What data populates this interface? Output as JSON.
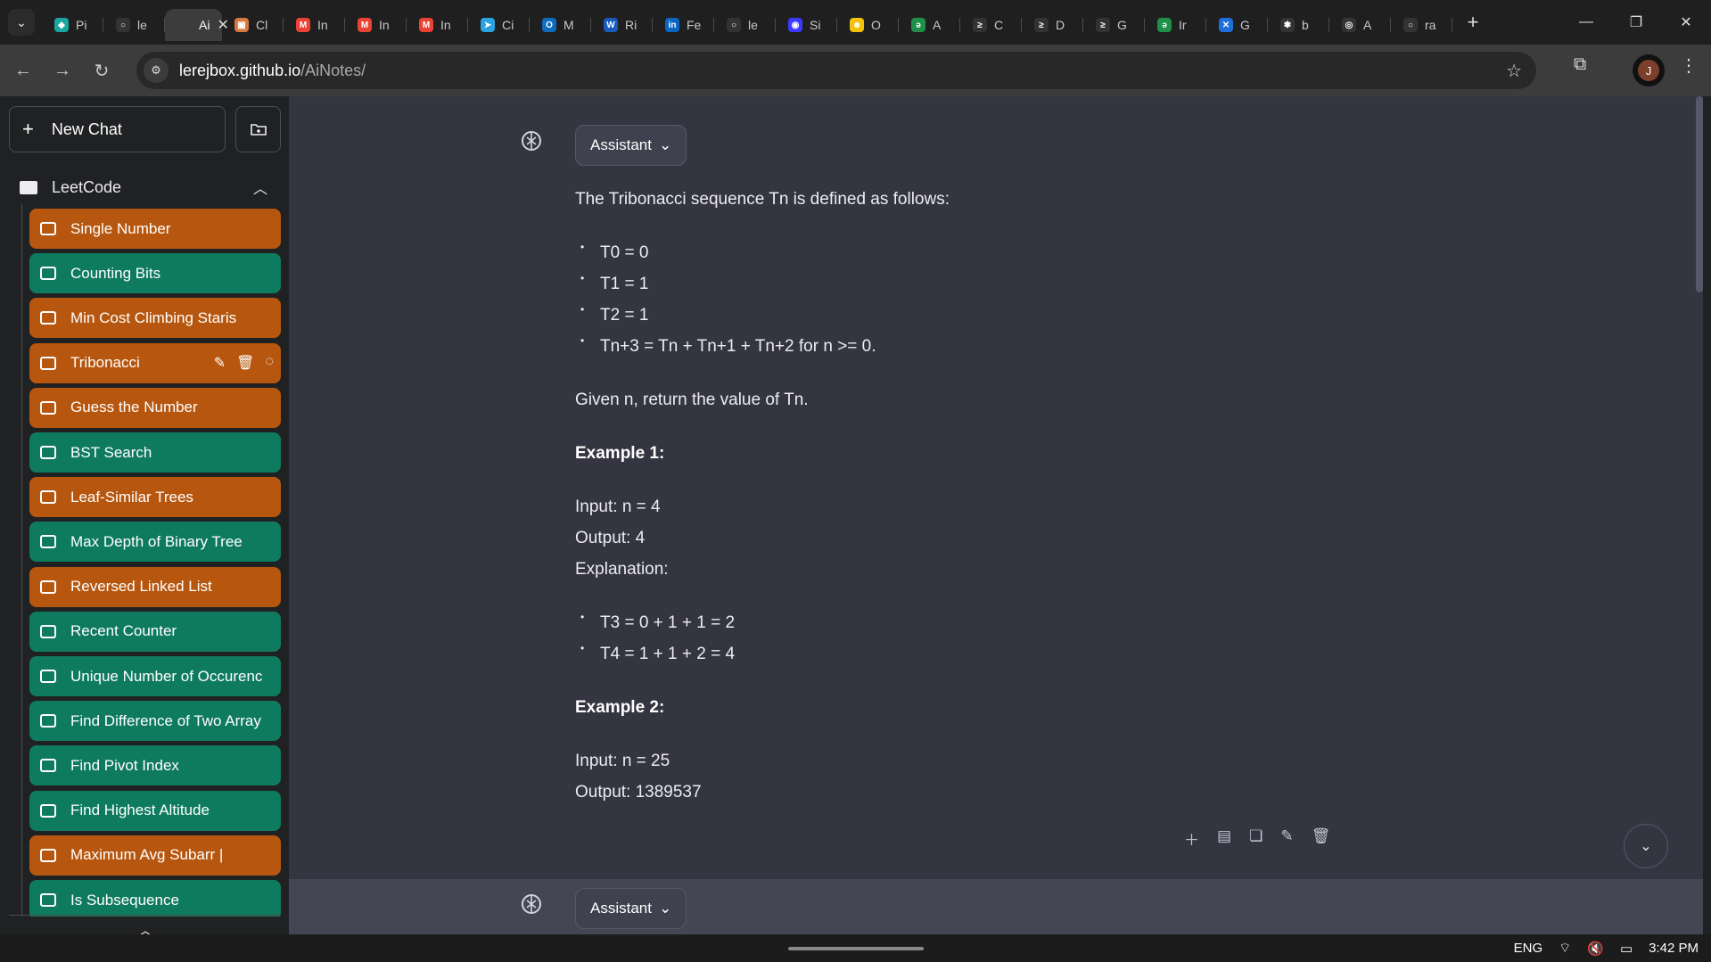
{
  "browser": {
    "tabs": [
      {
        "label": "Pi",
        "color": "#1aa7a1",
        "glyph": "◆"
      },
      {
        "label": "le",
        "color": "#333333",
        "glyph": "○"
      },
      {
        "label": "Ai",
        "active": true
      },
      {
        "label": "Cl",
        "color": "#d9773f",
        "glyph": "▣"
      },
      {
        "label": "In",
        "color": "#ea4335",
        "glyph": "M"
      },
      {
        "label": "In",
        "color": "#ea4335",
        "glyph": "M"
      },
      {
        "label": "In",
        "color": "#ea4335",
        "glyph": "M"
      },
      {
        "label": "Ci",
        "color": "#2aa3df",
        "glyph": "➤"
      },
      {
        "label": "M",
        "color": "#0f6cbd",
        "glyph": "O"
      },
      {
        "label": "Ri",
        "color": "#185abd",
        "glyph": "W"
      },
      {
        "label": "Fe",
        "color": "#0a66c2",
        "glyph": "in"
      },
      {
        "label": "le",
        "color": "#333333",
        "glyph": "○"
      },
      {
        "label": "Si",
        "color": "#3b3bff",
        "glyph": "◉"
      },
      {
        "label": "O",
        "color": "#f4c20d",
        "glyph": "☻"
      },
      {
        "label": "A",
        "color": "#1f8f4a",
        "glyph": "ǝ"
      },
      {
        "label": "C",
        "color": "#333333",
        "glyph": "≥"
      },
      {
        "label": "D",
        "color": "#333333",
        "glyph": "≥"
      },
      {
        "label": "G",
        "color": "#333333",
        "glyph": "≥"
      },
      {
        "label": "Ir",
        "color": "#1f8f4a",
        "glyph": "ǝ"
      },
      {
        "label": "G",
        "color": "#1e6fd9",
        "glyph": "✕"
      },
      {
        "label": "b",
        "color": "#333333",
        "glyph": "❃"
      },
      {
        "label": "A",
        "color": "#333333",
        "glyph": "◎"
      },
      {
        "label": "ra",
        "color": "#333333",
        "glyph": "○"
      }
    ],
    "active_close": "✕",
    "new_tab": "+",
    "url_host": "lerejbox.github.io",
    "url_path": "/AiNotes/",
    "profile_initial": "J"
  },
  "sidebar": {
    "new_chat_label": "New Chat",
    "folder_name": "LeetCode",
    "conversations": [
      {
        "title": "Single Number",
        "color": "orange"
      },
      {
        "title": "Counting Bits",
        "color": "green"
      },
      {
        "title": "Min Cost Climbing Staris",
        "color": "orange"
      },
      {
        "title": "Tribonacci",
        "color": "orange",
        "selected": true
      },
      {
        "title": "Guess the Number",
        "color": "orange"
      },
      {
        "title": "BST Search",
        "color": "green"
      },
      {
        "title": "Leaf-Similar Trees",
        "color": "orange"
      },
      {
        "title": "Max Depth of Binary Tree",
        "color": "green"
      },
      {
        "title": "Reversed Linked List",
        "color": "orange"
      },
      {
        "title": "Recent Counter",
        "color": "green"
      },
      {
        "title": "Unique Number of Occurenc",
        "color": "green"
      },
      {
        "title": "Find Difference of Two Array",
        "color": "green"
      },
      {
        "title": "Find Pivot Index",
        "color": "green"
      },
      {
        "title": "Find Highest Altitude",
        "color": "green"
      },
      {
        "title": "Maximum Avg Subarr |",
        "color": "orange"
      },
      {
        "title": "Is Subsequence",
        "color": "green"
      }
    ]
  },
  "chat": {
    "role_label": "Assistant",
    "intro": "The Tribonacci sequence Tn is defined as follows:",
    "defs": [
      "T0 = 0",
      "T1 = 1",
      "T2 = 1",
      "Tn+3 = Tn + Tn+1 + Tn+2 for n >= 0."
    ],
    "task": "Given n, return the value of Tn.",
    "ex1_title": "Example 1:",
    "ex1_input": "Input: n = 4",
    "ex1_output": "Output: 4",
    "ex1_expl": "Explanation:",
    "ex1_steps": [
      "T3 = 0 + 1 + 1 = 2",
      "T4 = 1 + 1 + 2 = 4"
    ],
    "ex2_title": "Example 2:",
    "ex2_input": "Input: n = 25",
    "ex2_output": "Output: 1389537",
    "second_role_label": "Assistant"
  },
  "taskbar": {
    "lang": "ENG",
    "time": "3:42 PM"
  }
}
